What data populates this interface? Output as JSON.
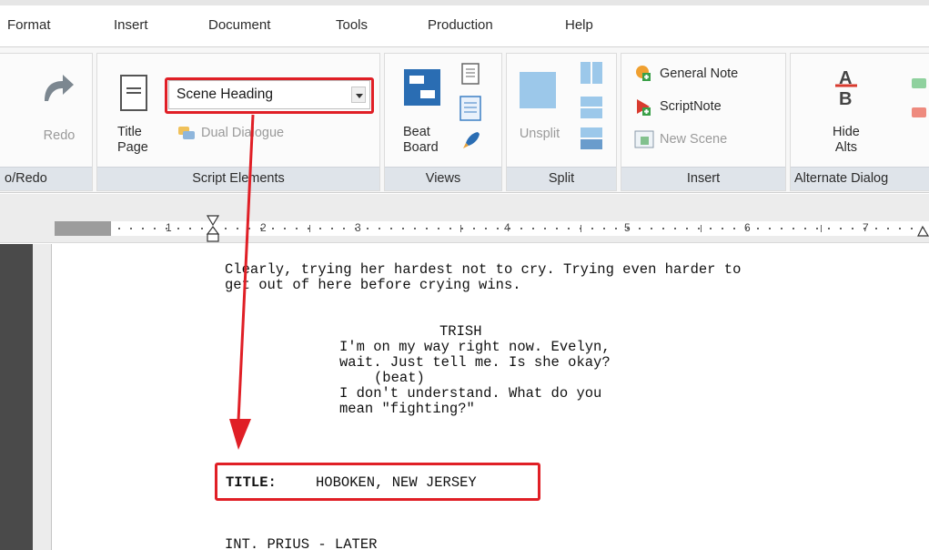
{
  "menu": [
    "Format",
    "Insert",
    "Document",
    "Tools",
    "Production",
    "Help"
  ],
  "ribbon": {
    "undo_redo": {
      "redo_label": "Redo",
      "group_label": "o/Redo"
    },
    "script_elements": {
      "title_page_label_1": "Title",
      "title_page_label_2": "Page",
      "select_value": "Scene Heading",
      "dual_dialogue_label": "Dual Dialogue",
      "group_label": "Script Elements"
    },
    "views": {
      "beat_board_label_1": "Beat",
      "beat_board_label_2": "Board",
      "group_label": "Views"
    },
    "split": {
      "unsplit_label": "Unsplit",
      "group_label": "Split"
    },
    "insert": {
      "general_note_label": "General Note",
      "scriptnote_label": "ScriptNote",
      "new_scene_label": "New Scene",
      "group_label": "Insert"
    },
    "alternate_dialogue": {
      "hide_alts_label_1": "Hide",
      "hide_alts_label_2": "Alts",
      "group_label": "Alternate Dialog"
    }
  },
  "ruler": {
    "numbers": [
      "1",
      "2",
      "3",
      "4",
      "5",
      "6",
      "7"
    ]
  },
  "script": {
    "action_line_1": "Clearly, trying her hardest not to cry. Trying even harder to",
    "action_line_2": "get out of here before crying wins.",
    "character": "TRISH",
    "dialogue_1": "I'm on my way right now. Evelyn,",
    "dialogue_2": "wait. Just tell me. Is she okay?",
    "parenthetical": "(beat)",
    "dialogue_3": "I don't understand. What do you",
    "dialogue_4": "mean \"fighting?\"",
    "title_label": "TITLE:",
    "title_value": "HOBOKEN, NEW JERSEY",
    "scene_heading": "INT. PRIUS - LATER"
  },
  "colors": {
    "highlight": "#e01f26",
    "ribbon_label_bg": "#dfe4ea"
  }
}
